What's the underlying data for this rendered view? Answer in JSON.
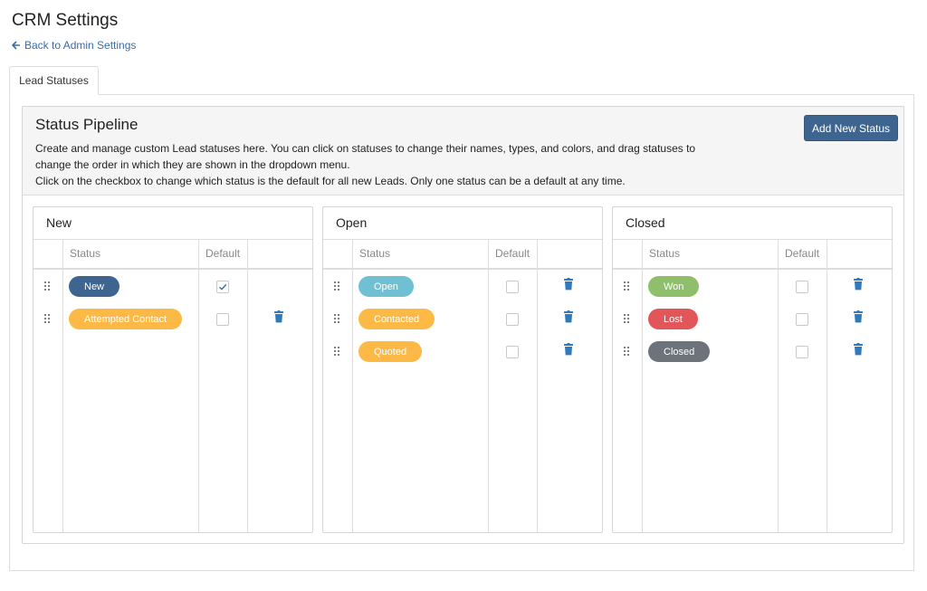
{
  "page": {
    "title": "CRM Settings",
    "back_link": "Back to Admin Settings"
  },
  "tabs": [
    {
      "label": "Lead Statuses",
      "active": true
    }
  ],
  "pipeline": {
    "title": "Status Pipeline",
    "desc_line1": "Create and manage custom Lead statuses here. You can click on statuses to change their names, types, and colors, and drag statuses to change the order in which they are shown in the dropdown menu.",
    "desc_line2": "Click on the checkbox to change which status is the default for all new Leads. Only one status can be a default at any time.",
    "add_button": "Add New Status"
  },
  "table_headers": {
    "status": "Status",
    "default": "Default"
  },
  "columns": [
    {
      "title": "New",
      "statuses": [
        {
          "label": "New",
          "color": "#3e6590",
          "default": true,
          "deletable": false
        },
        {
          "label": "Attempted Contact",
          "color": "#fdb945",
          "default": false,
          "deletable": true
        }
      ]
    },
    {
      "title": "Open",
      "statuses": [
        {
          "label": "Open",
          "color": "#6fc0d2",
          "default": false,
          "deletable": true
        },
        {
          "label": "Contacted",
          "color": "#fdb945",
          "default": false,
          "deletable": true
        },
        {
          "label": "Quoted",
          "color": "#fdb945",
          "default": false,
          "deletable": true
        }
      ]
    },
    {
      "title": "Closed",
      "statuses": [
        {
          "label": "Won",
          "color": "#8fbf6a",
          "default": false,
          "deletable": true
        },
        {
          "label": "Lost",
          "color": "#e2565a",
          "default": false,
          "deletable": true
        },
        {
          "label": "Closed",
          "color": "#6c737a",
          "default": false,
          "deletable": true
        }
      ]
    }
  ],
  "colors": {
    "link": "#3a6da5",
    "primary_button": "#3e6590",
    "trash_icon": "#2f7abf"
  },
  "icons": {
    "back": "arrow-left-icon",
    "drag": "drag-handle-icon",
    "delete": "trash-icon",
    "check": "checkmark-icon"
  }
}
